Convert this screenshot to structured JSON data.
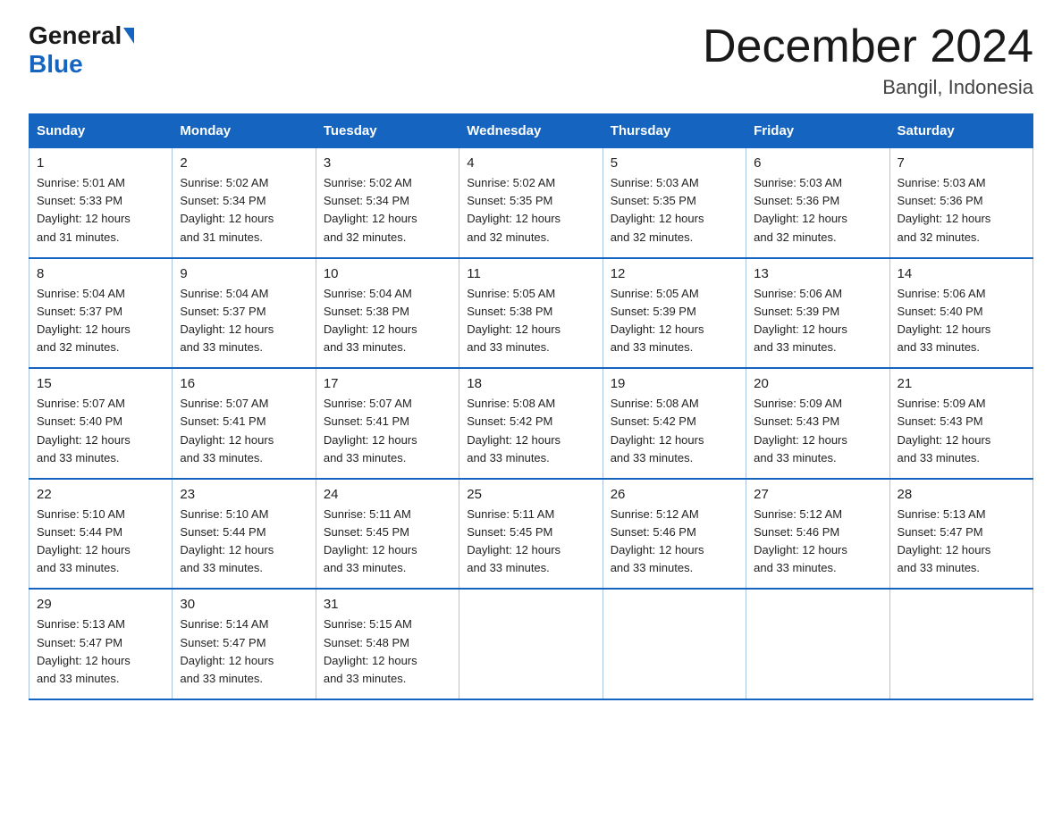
{
  "header": {
    "logo_general": "General",
    "logo_blue": "Blue",
    "title": "December 2024",
    "subtitle": "Bangil, Indonesia"
  },
  "days_of_week": [
    "Sunday",
    "Monday",
    "Tuesday",
    "Wednesday",
    "Thursday",
    "Friday",
    "Saturday"
  ],
  "weeks": [
    [
      {
        "num": "1",
        "sunrise": "5:01 AM",
        "sunset": "5:33 PM",
        "daylight": "12 hours and 31 minutes."
      },
      {
        "num": "2",
        "sunrise": "5:02 AM",
        "sunset": "5:34 PM",
        "daylight": "12 hours and 31 minutes."
      },
      {
        "num": "3",
        "sunrise": "5:02 AM",
        "sunset": "5:34 PM",
        "daylight": "12 hours and 32 minutes."
      },
      {
        "num": "4",
        "sunrise": "5:02 AM",
        "sunset": "5:35 PM",
        "daylight": "12 hours and 32 minutes."
      },
      {
        "num": "5",
        "sunrise": "5:03 AM",
        "sunset": "5:35 PM",
        "daylight": "12 hours and 32 minutes."
      },
      {
        "num": "6",
        "sunrise": "5:03 AM",
        "sunset": "5:36 PM",
        "daylight": "12 hours and 32 minutes."
      },
      {
        "num": "7",
        "sunrise": "5:03 AM",
        "sunset": "5:36 PM",
        "daylight": "12 hours and 32 minutes."
      }
    ],
    [
      {
        "num": "8",
        "sunrise": "5:04 AM",
        "sunset": "5:37 PM",
        "daylight": "12 hours and 32 minutes."
      },
      {
        "num": "9",
        "sunrise": "5:04 AM",
        "sunset": "5:37 PM",
        "daylight": "12 hours and 33 minutes."
      },
      {
        "num": "10",
        "sunrise": "5:04 AM",
        "sunset": "5:38 PM",
        "daylight": "12 hours and 33 minutes."
      },
      {
        "num": "11",
        "sunrise": "5:05 AM",
        "sunset": "5:38 PM",
        "daylight": "12 hours and 33 minutes."
      },
      {
        "num": "12",
        "sunrise": "5:05 AM",
        "sunset": "5:39 PM",
        "daylight": "12 hours and 33 minutes."
      },
      {
        "num": "13",
        "sunrise": "5:06 AM",
        "sunset": "5:39 PM",
        "daylight": "12 hours and 33 minutes."
      },
      {
        "num": "14",
        "sunrise": "5:06 AM",
        "sunset": "5:40 PM",
        "daylight": "12 hours and 33 minutes."
      }
    ],
    [
      {
        "num": "15",
        "sunrise": "5:07 AM",
        "sunset": "5:40 PM",
        "daylight": "12 hours and 33 minutes."
      },
      {
        "num": "16",
        "sunrise": "5:07 AM",
        "sunset": "5:41 PM",
        "daylight": "12 hours and 33 minutes."
      },
      {
        "num": "17",
        "sunrise": "5:07 AM",
        "sunset": "5:41 PM",
        "daylight": "12 hours and 33 minutes."
      },
      {
        "num": "18",
        "sunrise": "5:08 AM",
        "sunset": "5:42 PM",
        "daylight": "12 hours and 33 minutes."
      },
      {
        "num": "19",
        "sunrise": "5:08 AM",
        "sunset": "5:42 PM",
        "daylight": "12 hours and 33 minutes."
      },
      {
        "num": "20",
        "sunrise": "5:09 AM",
        "sunset": "5:43 PM",
        "daylight": "12 hours and 33 minutes."
      },
      {
        "num": "21",
        "sunrise": "5:09 AM",
        "sunset": "5:43 PM",
        "daylight": "12 hours and 33 minutes."
      }
    ],
    [
      {
        "num": "22",
        "sunrise": "5:10 AM",
        "sunset": "5:44 PM",
        "daylight": "12 hours and 33 minutes."
      },
      {
        "num": "23",
        "sunrise": "5:10 AM",
        "sunset": "5:44 PM",
        "daylight": "12 hours and 33 minutes."
      },
      {
        "num": "24",
        "sunrise": "5:11 AM",
        "sunset": "5:45 PM",
        "daylight": "12 hours and 33 minutes."
      },
      {
        "num": "25",
        "sunrise": "5:11 AM",
        "sunset": "5:45 PM",
        "daylight": "12 hours and 33 minutes."
      },
      {
        "num": "26",
        "sunrise": "5:12 AM",
        "sunset": "5:46 PM",
        "daylight": "12 hours and 33 minutes."
      },
      {
        "num": "27",
        "sunrise": "5:12 AM",
        "sunset": "5:46 PM",
        "daylight": "12 hours and 33 minutes."
      },
      {
        "num": "28",
        "sunrise": "5:13 AM",
        "sunset": "5:47 PM",
        "daylight": "12 hours and 33 minutes."
      }
    ],
    [
      {
        "num": "29",
        "sunrise": "5:13 AM",
        "sunset": "5:47 PM",
        "daylight": "12 hours and 33 minutes."
      },
      {
        "num": "30",
        "sunrise": "5:14 AM",
        "sunset": "5:47 PM",
        "daylight": "12 hours and 33 minutes."
      },
      {
        "num": "31",
        "sunrise": "5:15 AM",
        "sunset": "5:48 PM",
        "daylight": "12 hours and 33 minutes."
      },
      null,
      null,
      null,
      null
    ]
  ]
}
